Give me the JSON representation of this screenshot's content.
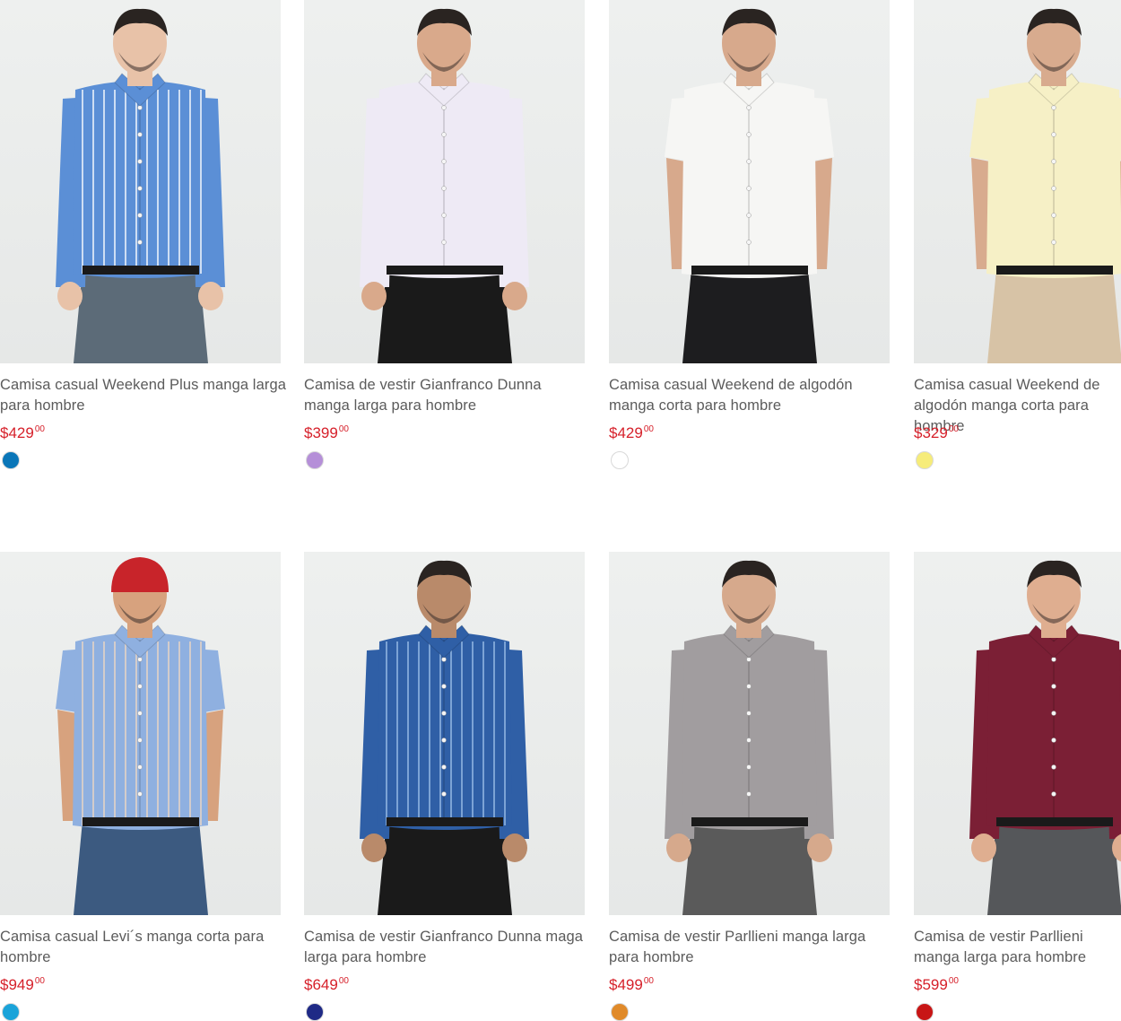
{
  "products": [
    {
      "title": "Camisa casual Weekend Plus manga larga para hombre",
      "price": "$429",
      "cents": "00",
      "swatch": "#0a76b8",
      "shirt": "#5b8fd6",
      "stripe": "#ffffff",
      "pants": "#5c6b78",
      "skin": "#e8c2a8"
    },
    {
      "title": "Camisa de vestir Gianfranco Dunna manga larga para hombre",
      "price": "$399",
      "cents": "00",
      "swatch": "#b58fd8",
      "shirt": "#eeeaf5",
      "stripe": "",
      "pants": "#1a1a1a",
      "skin": "#d9a98b"
    },
    {
      "title": "Camisa casual Weekend de algodón manga corta para hombre",
      "price": "$429",
      "cents": "00",
      "swatch": "#ffffff",
      "shirt": "#f6f6f4",
      "stripe": "",
      "pants": "#1d1d1f",
      "skin": "#d7a98c"
    },
    {
      "title": "Camisa casual Weekend de algodón manga corta para hombre",
      "price": "$329",
      "cents": "00",
      "swatch": "#f6ec7a",
      "shirt": "#f6f0c6",
      "stripe": "",
      "pants": "#d7c3a6",
      "skin": "#d8ab8e"
    },
    {
      "title": "Camisa casual Levi´s manga corta para hombre",
      "price": "$949",
      "cents": "00",
      "swatch": "#1aa3d9",
      "shirt": "#8fb0e0",
      "stripe": "#f0d9c2",
      "pants": "#3c5a80",
      "skin": "#d7a27e"
    },
    {
      "title": "Camisa de vestir Gianfranco Dunna maga larga para hombre",
      "price": "$649",
      "cents": "00",
      "swatch": "#1f2a86",
      "shirt": "#2f5fa6",
      "stripe": "#9cc0ea",
      "pants": "#1a1a1a",
      "skin": "#b98a6a"
    },
    {
      "title": "Camisa de vestir Parllieni manga larga para hombre",
      "price": "$499",
      "cents": "00",
      "swatch": "#e08a2a",
      "shirt": "#a19d9f",
      "stripe": "",
      "pants": "#5a5a5a",
      "skin": "#d6a98c"
    },
    {
      "title": "Camisa de vestir Parllieni manga larga para hombre",
      "price": "$599",
      "cents": "00",
      "swatch": "#c81515",
      "shirt": "#7b1f35",
      "stripe": "",
      "pants": "#55575a",
      "skin": "#dfae90"
    }
  ]
}
